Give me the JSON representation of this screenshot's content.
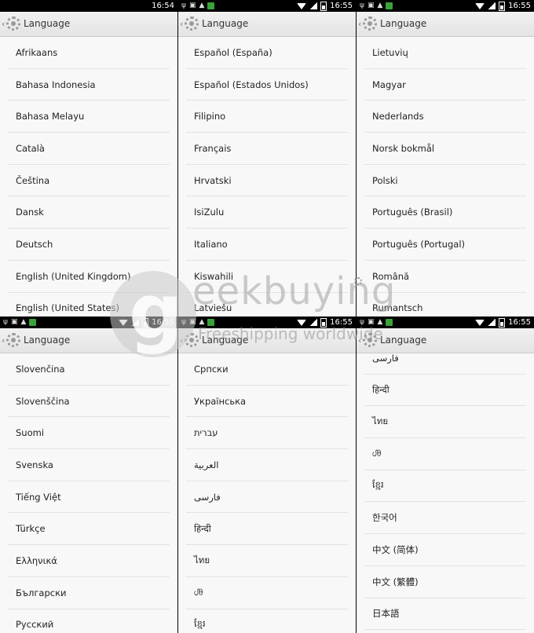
{
  "header": {
    "title": "Language"
  },
  "status": {
    "times": [
      "16:54",
      "16:55",
      "16:55",
      "16:55",
      "16:55",
      "16:55"
    ]
  },
  "panels": [
    [
      "Afrikaans",
      "Bahasa Indonesia",
      "Bahasa Melayu",
      "Català",
      "Čeština",
      "Dansk",
      "Deutsch",
      "English (United Kingdom)",
      "English (United States)"
    ],
    [
      "Español (España)",
      "Español (Estados Unidos)",
      "Filipino",
      "Français",
      "Hrvatski",
      "IsiZulu",
      "Italiano",
      "Kiswahili",
      "Latviešu"
    ],
    [
      "Lietuvių",
      "Magyar",
      "Nederlands",
      "Norsk bokmål",
      "Polski",
      "Português (Brasil)",
      "Português (Portugal)",
      "Română",
      "Rumantsch"
    ],
    [
      "Slovenčina",
      "Slovenščina",
      "Suomi",
      "Svenska",
      "Tiếng Việt",
      "Türkçe",
      "Ελληνικά",
      "Български",
      "Русский"
    ],
    [
      "Српски",
      "Українська",
      "עברית",
      "العربية",
      "فارسی",
      "हिन्दी",
      "ไทย",
      "ᦔᦲ",
      "ខ្មែរ"
    ],
    [
      "فارسی",
      "हिन्दी",
      "ไทย",
      "ᦔᦲ",
      "ខ្មែរ",
      "한국어",
      "中文 (简体)",
      "中文 (繁體)",
      "日本語"
    ]
  ],
  "watermark": {
    "brand": "eekbuying",
    "brand_initial": "g",
    "tagline": "Freeshipping worldwide"
  }
}
